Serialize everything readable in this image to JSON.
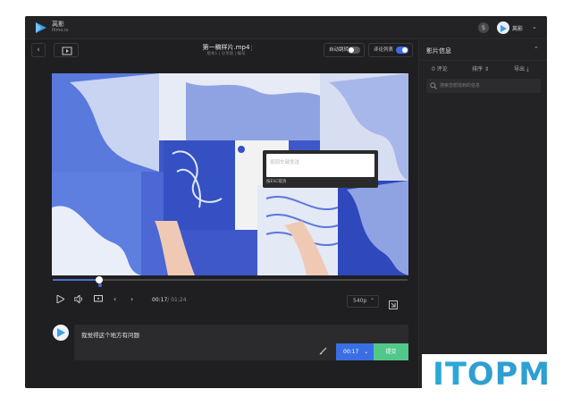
{
  "topbar": {
    "brand_name": "莴影",
    "brand_domain": "filmo.io",
    "help_label": "$",
    "user_name": "莴影"
  },
  "header": {
    "file_name": "第一稿样片.mp4",
    "file_meta": "版本1 | 分享链 | 编号",
    "toggle_autoplay": "自动跳转",
    "toggle_comments": "评论列表"
  },
  "video": {
    "progress": 0.13,
    "popup_placeholder": "按回车键发送",
    "popup_hint": "按ESC取消"
  },
  "controls": {
    "current_time": "00:17",
    "duration": "/ 01:24",
    "quality": "540p"
  },
  "composer": {
    "comment_text": "我觉得这个地方有问题",
    "timecode": "00:17",
    "submit_label": "提交"
  },
  "panel": {
    "title": "影片信息",
    "comment_count": "0 评论",
    "sort_label": "排序",
    "export_label": "导出",
    "search_placeholder": "搜索您想找到的信息"
  },
  "watermark": {
    "text_left": "IT",
    "text_right": "OPM"
  },
  "colors": {
    "accent_blue": "#3a6fe4",
    "submit_green": "#52c78a",
    "background": "#1f1f21"
  }
}
